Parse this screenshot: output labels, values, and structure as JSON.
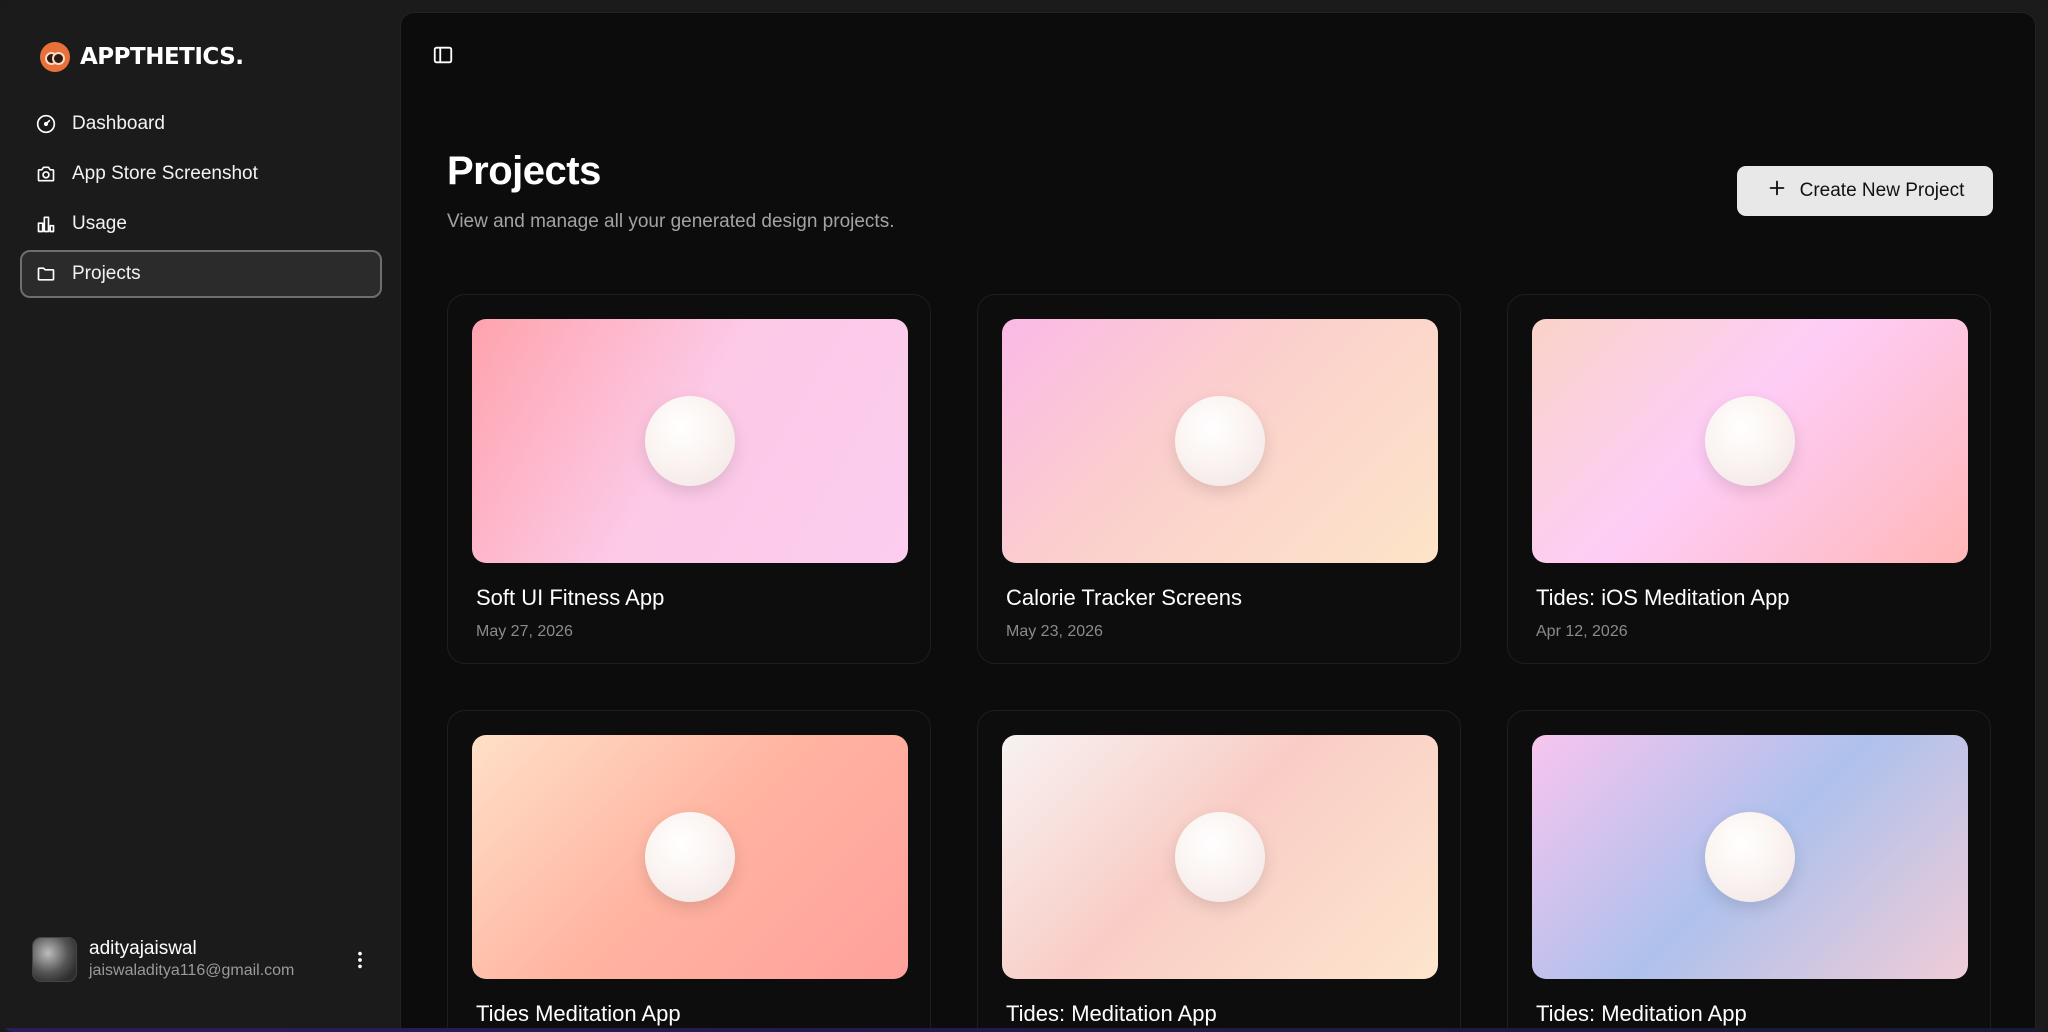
{
  "app": {
    "name": "APPTHETICS."
  },
  "sidebar": {
    "items": [
      {
        "label": "Dashboard",
        "icon": "gauge-icon",
        "active": false
      },
      {
        "label": "App Store Screenshot",
        "icon": "camera-icon",
        "active": false
      },
      {
        "label": "Usage",
        "icon": "bar-chart-icon",
        "active": false
      },
      {
        "label": "Projects",
        "icon": "folder-icon",
        "active": true
      }
    ],
    "user": {
      "name": "adityajaiswal",
      "email": "jaiswaladitya116@gmail.com",
      "menu_icon": "more-vertical-icon"
    }
  },
  "header": {
    "toggle_icon": "sidebar-toggle-icon"
  },
  "main": {
    "title": "Projects",
    "subtitle": "View and manage all your generated design projects.",
    "create_button": {
      "label": "Create New Project",
      "icon": "plus-icon"
    },
    "projects": [
      {
        "title": "Soft UI Fitness App",
        "date": "May 27, 2026"
      },
      {
        "title": "Calorie Tracker Screens",
        "date": "May 23, 2026"
      },
      {
        "title": "Tides: iOS Meditation App",
        "date": "Apr 12, 2026"
      },
      {
        "title": "Tides Meditation App",
        "date": ""
      },
      {
        "title": "Tides: Meditation App",
        "date": ""
      },
      {
        "title": "Tides: Meditation App",
        "date": ""
      }
    ]
  },
  "colors": {
    "sidebar_bg": "#1b1b1b",
    "main_bg": "#0c0c0c",
    "accent_logo": "#e8703a",
    "button_bg": "#e8e8e8"
  }
}
